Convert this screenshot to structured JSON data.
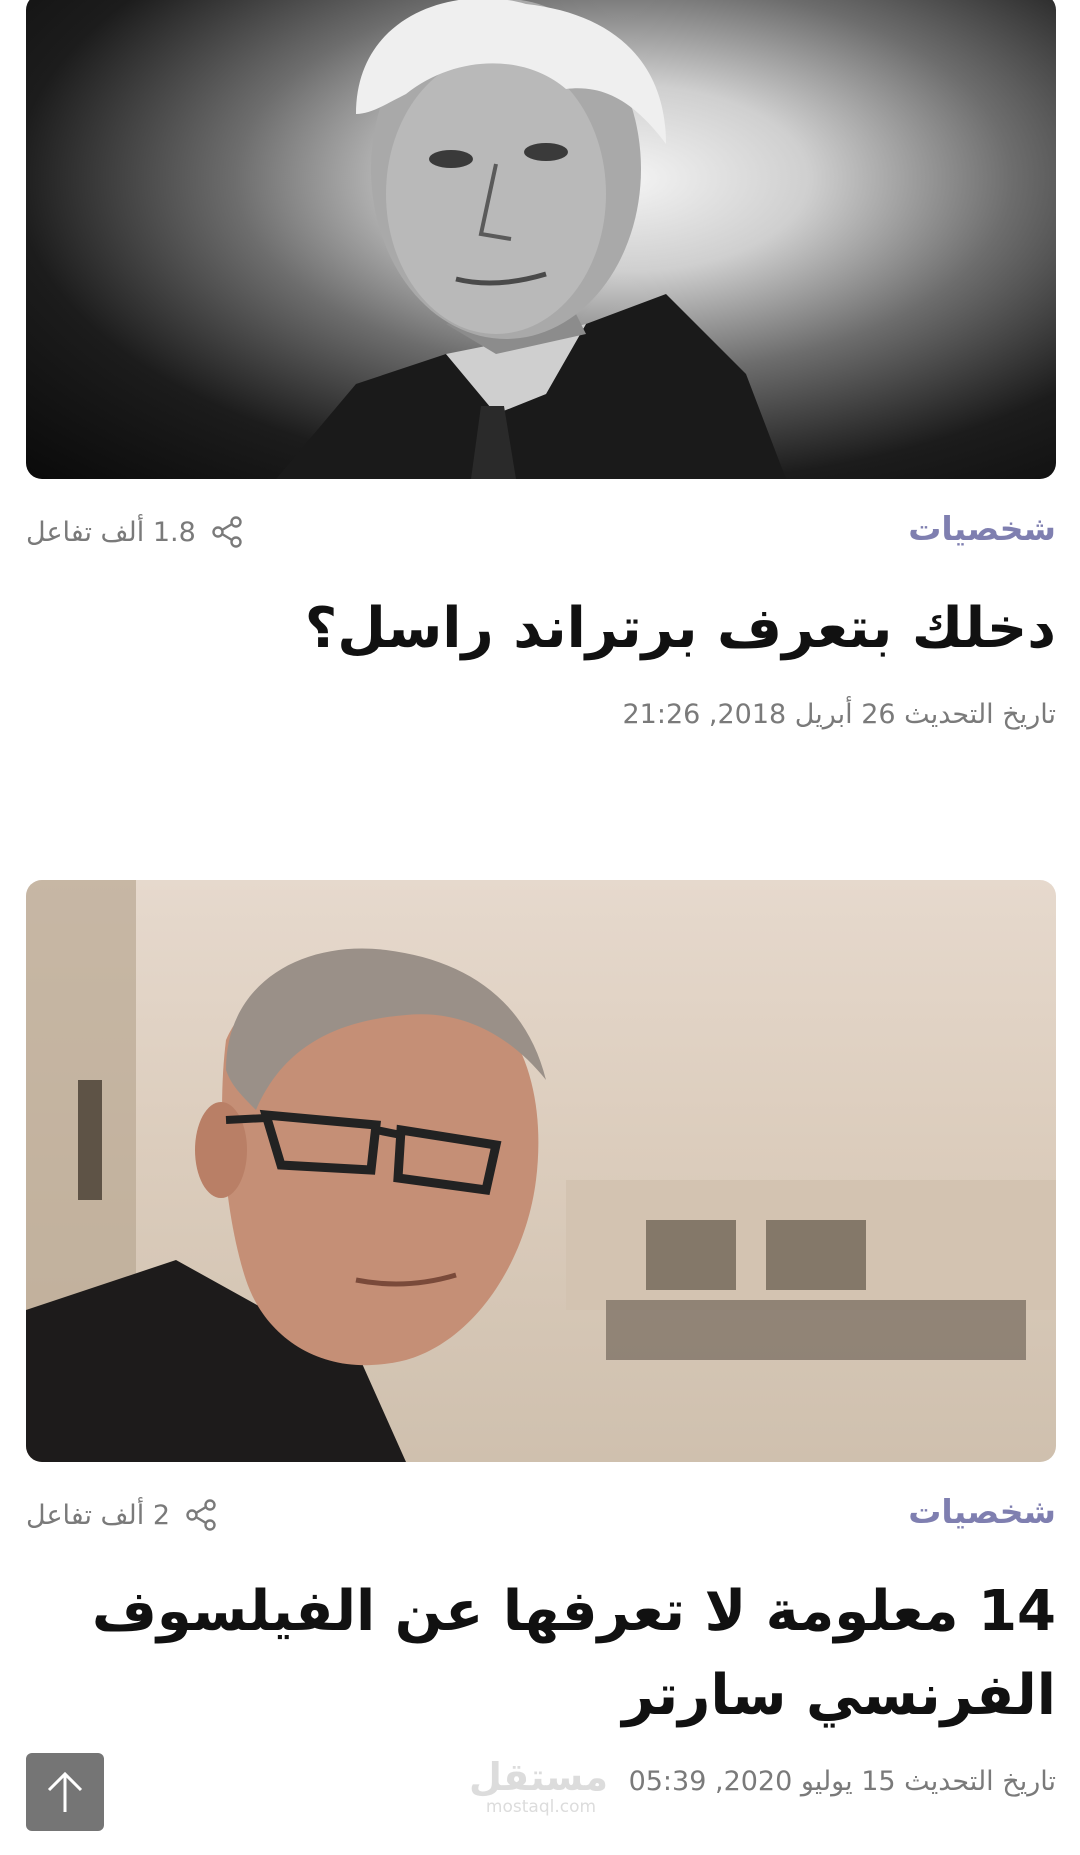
{
  "articles": [
    {
      "image_subject": "black-and-white portrait of an elderly man",
      "category": "شخصيات",
      "reactions": "1.8 ألف تفاعل",
      "title": "دخلك بتعرف برتراند راسل؟",
      "date": "تاريخ التحديث 26 أبريل 2018, 21:26"
    },
    {
      "image_subject": "color portrait of a man with glasses",
      "category": "شخصيات",
      "reactions": "2 ألف تفاعل",
      "title": "14 معلومة لا تعرفها عن الفيلسوف الفرنسي سارتر",
      "date": "تاريخ التحديث 15 يوليو 2020, 05:39"
    }
  ],
  "watermark": {
    "logo": "مستقل",
    "url": "mostaql.com"
  },
  "icons": {
    "share": "share-icon",
    "scroll_top": "arrow-up-icon"
  },
  "colors": {
    "category": "#7f7fb0",
    "meta_text": "#7a7a7a",
    "title": "#111111",
    "scroll_button": "#757575"
  }
}
